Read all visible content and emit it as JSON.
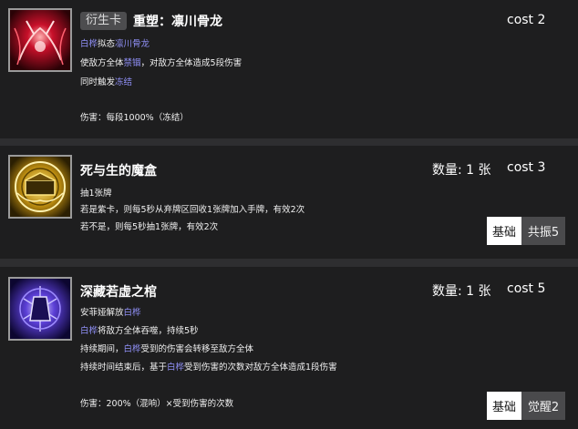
{
  "cards": [
    {
      "tag": "衍生卡",
      "title": "重塑：凛川骨龙",
      "cost": "cost 2",
      "lines": [
        [
          {
            "t": "白桦",
            "hl": true
          },
          {
            "t": "拟态",
            "hl": false
          },
          {
            "t": "凛川骨龙",
            "hl": true
          }
        ],
        [
          {
            "t": "使敌方全体",
            "hl": false
          },
          {
            "t": "禁锢",
            "hl": true
          },
          {
            "t": "，对敌方全体造成5段伤害",
            "hl": false
          }
        ],
        [
          {
            "t": "同时触发",
            "hl": false
          },
          {
            "t": "冻结",
            "hl": true
          }
        ],
        [
          {
            "t": "伤害：每段1000%（冻结）",
            "hl": false
          }
        ]
      ]
    },
    {
      "title": "死与生的魔盒",
      "count": "数量: 1 张",
      "cost": "cost 3",
      "lines": [
        [
          {
            "t": "抽1张牌",
            "hl": false
          }
        ],
        [
          {
            "t": "若是紫卡，则每5秒从弃牌区回收1张牌加入手牌，有效2次",
            "hl": false
          }
        ],
        [
          {
            "t": "若不是，则每5秒抽1张牌，有效2次",
            "hl": false
          }
        ]
      ],
      "btn_a": "基础",
      "btn_b": "共振5"
    },
    {
      "title": "深藏若虚之棺",
      "count": "数量: 1 张",
      "cost": "cost 5",
      "lines": [
        [
          {
            "t": "安菲娅解放",
            "hl": false
          },
          {
            "t": "白桦",
            "hl": true
          }
        ],
        [
          {
            "t": "白桦",
            "hl": true
          },
          {
            "t": "将敌方全体吞噬，持续5秒",
            "hl": false
          }
        ],
        [
          {
            "t": "持续期间，",
            "hl": false
          },
          {
            "t": "白桦",
            "hl": true
          },
          {
            "t": "受到的伤害会转移至敌方全体",
            "hl": false
          }
        ],
        [
          {
            "t": "持续时间结束后，基于",
            "hl": false
          },
          {
            "t": "白桦",
            "hl": true
          },
          {
            "t": "受到伤害的次数对敌方全体造成1段伤害",
            "hl": false
          }
        ],
        [
          {
            "t": "伤害：200%（混响）×受到伤害的次数",
            "hl": false
          }
        ]
      ],
      "btn_a": "基础",
      "btn_b": "觉醒2"
    }
  ]
}
